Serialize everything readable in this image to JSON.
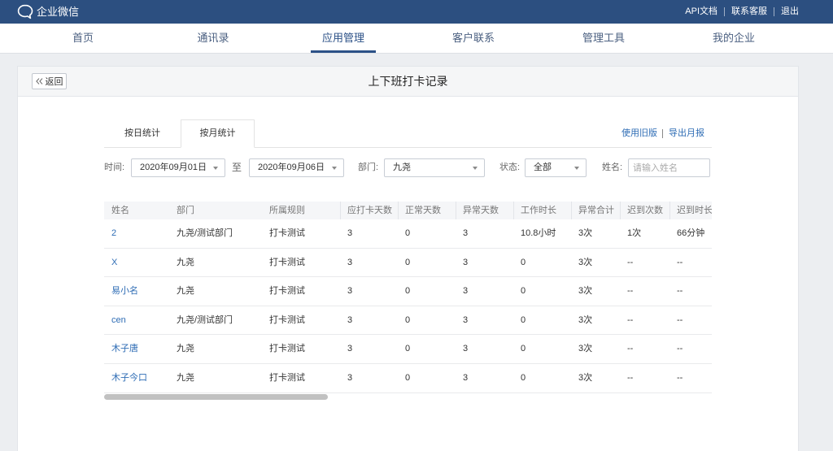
{
  "app": {
    "title": "企业微信",
    "logo_icon": "chat-bubble-icon"
  },
  "topbar": {
    "api_docs": "API文档",
    "contact_support": "联系客服",
    "logout": "退出"
  },
  "nav": {
    "items": [
      {
        "label": "首页",
        "active": false
      },
      {
        "label": "通讯录",
        "active": false
      },
      {
        "label": "应用管理",
        "active": true
      },
      {
        "label": "客户联系",
        "active": false
      },
      {
        "label": "管理工具",
        "active": false
      },
      {
        "label": "我的企业",
        "active": false
      }
    ]
  },
  "panel": {
    "back": {
      "label": "返回",
      "icon": "double-chevron-left-icon"
    },
    "title": "上下班打卡记录"
  },
  "tabs": [
    {
      "label": "按日统计",
      "active": false
    },
    {
      "label": "按月统计",
      "active": true
    }
  ],
  "actions": {
    "use_old_version": "使用旧版",
    "export_monthly_report": "导出月报"
  },
  "filters": {
    "dropdown_icon": "caret-down-icon",
    "time_label": "时间:",
    "start_date": "2020年09月01日",
    "to_label": "至",
    "end_date": "2020年09月06日",
    "department_label": "部门:",
    "department": "九尧",
    "status_label": "状态:",
    "status": "全部",
    "name_label": "姓名:",
    "name_placeholder": "请输入姓名"
  },
  "table": {
    "columns": [
      {
        "key": "name",
        "label": "姓名"
      },
      {
        "key": "department",
        "label": "部门"
      },
      {
        "key": "rule",
        "label": "所属规则"
      },
      {
        "key": "required_days",
        "label": "应打卡天数"
      },
      {
        "key": "normal_days",
        "label": "正常天数"
      },
      {
        "key": "abnormal_days",
        "label": "异常天数"
      },
      {
        "key": "work_hours",
        "label": "工作时长"
      },
      {
        "key": "abnormal_total",
        "label": "异常合计"
      },
      {
        "key": "late_count",
        "label": "迟到次数"
      },
      {
        "key": "late_duration",
        "label": "迟到时长"
      }
    ],
    "rows": [
      {
        "name": "2",
        "department": "九尧/测试部门",
        "rule": "打卡测试",
        "required_days": "3",
        "normal_days": "0",
        "abnormal_days": "3",
        "work_hours": "10.8小时",
        "abnormal_total": "3次",
        "late_count": "1次",
        "late_duration": "66分钟"
      },
      {
        "name": "X",
        "department": "九尧",
        "rule": "打卡测试",
        "required_days": "3",
        "normal_days": "0",
        "abnormal_days": "3",
        "work_hours": "0",
        "abnormal_total": "3次",
        "late_count": "--",
        "late_duration": "--"
      },
      {
        "name": "易小名",
        "department": "九尧",
        "rule": "打卡测试",
        "required_days": "3",
        "normal_days": "0",
        "abnormal_days": "3",
        "work_hours": "0",
        "abnormal_total": "3次",
        "late_count": "--",
        "late_duration": "--"
      },
      {
        "name": "cen",
        "department": "九尧/测试部门",
        "rule": "打卡测试",
        "required_days": "3",
        "normal_days": "0",
        "abnormal_days": "3",
        "work_hours": "0",
        "abnormal_total": "3次",
        "late_count": "--",
        "late_duration": "--"
      },
      {
        "name": "木子唐",
        "department": "九尧",
        "rule": "打卡测试",
        "required_days": "3",
        "normal_days": "0",
        "abnormal_days": "3",
        "work_hours": "0",
        "abnormal_total": "3次",
        "late_count": "--",
        "late_duration": "--"
      },
      {
        "name": "木子今口",
        "department": "九尧",
        "rule": "打卡测试",
        "required_days": "3",
        "normal_days": "0",
        "abnormal_days": "3",
        "work_hours": "0",
        "abnormal_total": "3次",
        "late_count": "--",
        "late_duration": "--"
      }
    ]
  },
  "colors": {
    "topbar_bg": "#2c4f80",
    "page_bg": "#eceef1",
    "accent": "#2c5187",
    "link": "#2f6db5",
    "nav_text": "#4a5f80"
  }
}
